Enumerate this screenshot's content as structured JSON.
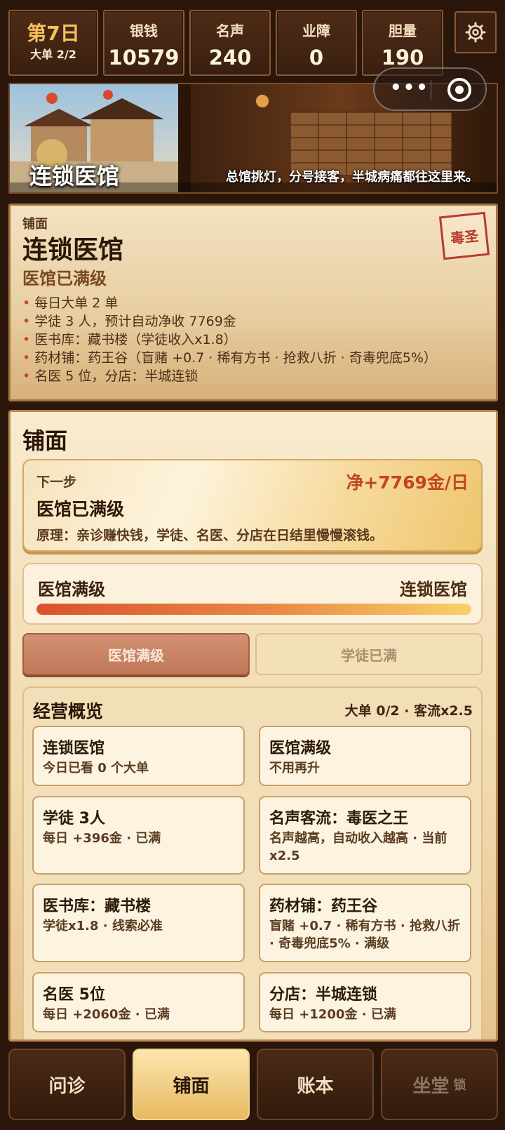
{
  "top": {
    "day": "第7日",
    "day_sub": "大单 2/2",
    "stats": [
      {
        "label": "银钱",
        "value": "10579"
      },
      {
        "label": "名声",
        "value": "240"
      },
      {
        "label": "业障",
        "value": "0"
      },
      {
        "label": "胆量",
        "value": "190"
      }
    ]
  },
  "banner": {
    "title": "连锁医馆",
    "desc": "总馆挑灯，分号接客，半城病痛都往这里来。"
  },
  "info": {
    "small": "铺面",
    "name": "连锁医馆",
    "stamp": "毒圣",
    "status": "医馆已满级",
    "lines": [
      "每日大单 2 单",
      "学徒 3 人，预计自动净收 7769金",
      "医书库：藏书楼（学徒收入x1.8）",
      "药材铺：药王谷（盲赌 +0.7 · 稀有方书 · 抢救八折 · 奇毒兜底5%）",
      "名医 5 位，分店：半城连锁"
    ]
  },
  "panel": {
    "title": "铺面",
    "next": {
      "label": "下一步",
      "value": "净+7769金/日",
      "title": "医馆已满级",
      "desc": "原理：亲诊赚快钱，学徒、名医、分店在日结里慢慢滚钱。"
    },
    "progress": {
      "left": "医馆满级",
      "right": "连锁医馆",
      "fraction": 1.0
    },
    "buttons": [
      "医馆满级",
      "学徒已满"
    ],
    "overview": {
      "title": "经营概览",
      "meta": "大单 0/2 · 客流x2.5",
      "cells": [
        {
          "title": "连锁医馆",
          "desc": "今日已看 0 个大单"
        },
        {
          "title": "医馆满级",
          "desc": "不用再升"
        },
        {
          "title": "学徒 3人",
          "desc": "每日 +396金 · 已满"
        },
        {
          "title": "名声客流：毒医之王",
          "desc": "名声越高，自动收入越高 · 当前x2.5"
        },
        {
          "title": "医书库：藏书楼",
          "desc": "学徒x1.8 · 线索必准"
        },
        {
          "title": "药材铺：药王谷",
          "desc": "盲赌 +0.7 · 稀有方书 · 抢救八折 · 奇毒兜底5% · 满级"
        },
        {
          "title": "名医 5位",
          "desc": "每日 +2060金 · 已满"
        },
        {
          "title": "分店：半城连锁",
          "desc": "每日 +1200金 · 已满"
        }
      ]
    }
  },
  "nav": {
    "tabs": [
      "问诊",
      "铺面",
      "账本",
      "坐堂"
    ],
    "lock": "锁",
    "active": 1
  },
  "colors": {
    "accent_red": "#c24423",
    "gold": "#e8b962",
    "dark_wood": "#3a1f10"
  },
  "icons": [
    "gear-icon",
    "more-dots-icon",
    "close-target-icon"
  ]
}
